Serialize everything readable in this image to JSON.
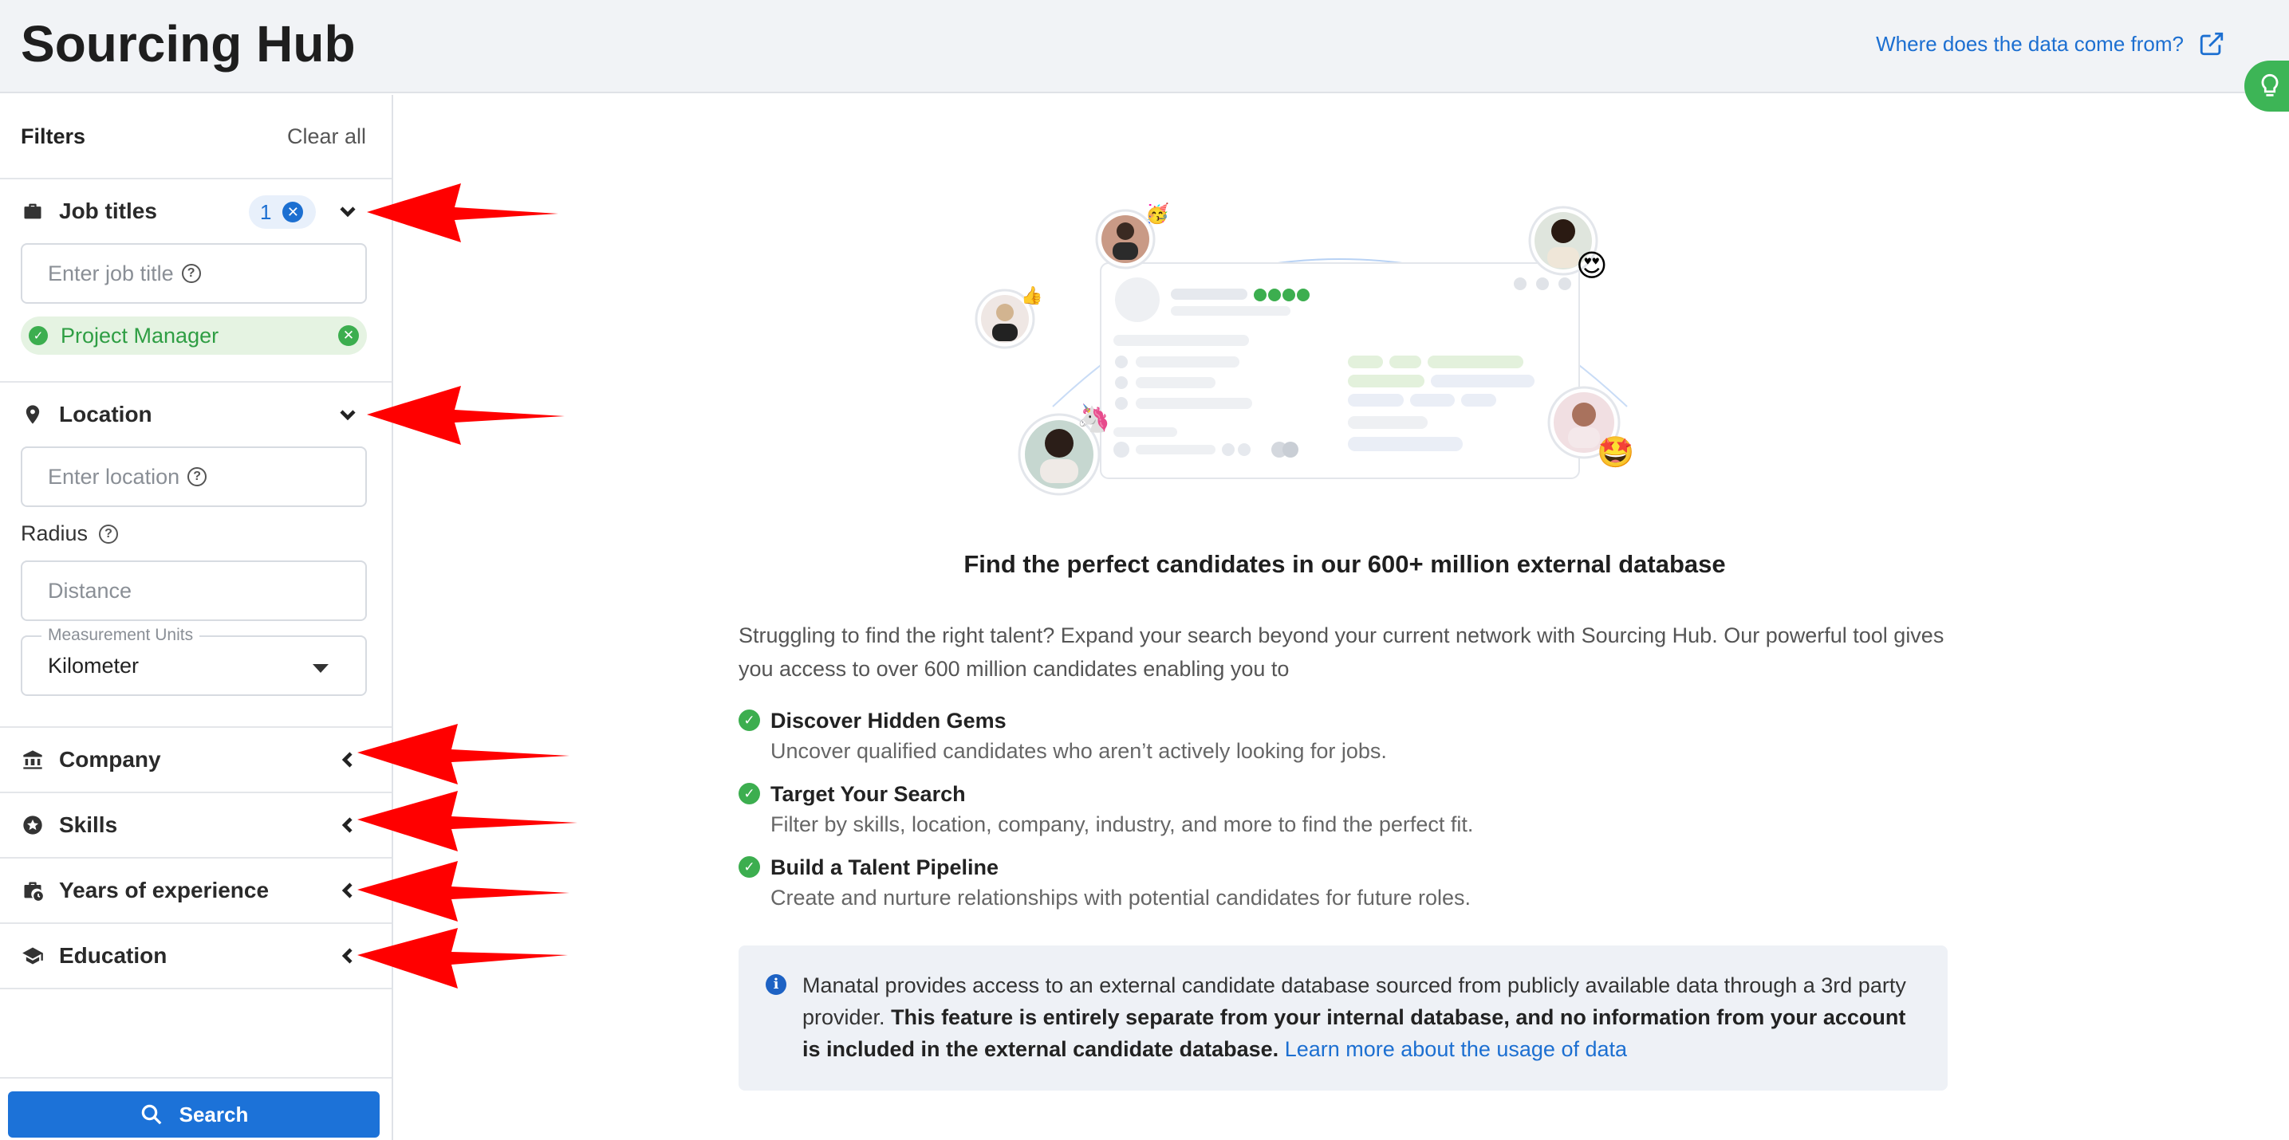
{
  "header": {
    "title": "Sourcing Hub",
    "data_link": "Where does the data come from?"
  },
  "sidebar": {
    "filters_title": "Filters",
    "clear_all": "Clear all",
    "job_titles": {
      "label": "Job titles",
      "count": "1",
      "placeholder": "Enter job title",
      "chip": "Project Manager"
    },
    "location": {
      "label": "Location",
      "placeholder": "Enter location",
      "radius_label": "Radius",
      "distance_placeholder": "Distance",
      "units_legend": "Measurement Units",
      "units_value": "Kilometer"
    },
    "sections": [
      {
        "label": "Company",
        "icon": "bank-icon"
      },
      {
        "label": "Skills",
        "icon": "star-badge-icon"
      },
      {
        "label": "Years of experience",
        "icon": "briefcase-clock-icon"
      },
      {
        "label": "Education",
        "icon": "graduation-cap-icon"
      }
    ],
    "search_button": "Search"
  },
  "main": {
    "headline": "Find the perfect candidates in our 600+ million external database",
    "intro": "Struggling to find the right talent? Expand your search beyond your current network with Sourcing Hub. Our powerful tool gives you access to over 600 million candidates enabling you to",
    "features": [
      {
        "title": "Discover Hidden Gems",
        "desc": "Uncover qualified candidates who aren’t actively looking for jobs."
      },
      {
        "title": "Target Your Search",
        "desc": "Filter by skills, location, company, industry, and more to find the perfect fit."
      },
      {
        "title": "Build a Talent Pipeline",
        "desc": "Create and nurture relationships with potential candidates for future roles."
      }
    ],
    "notice": {
      "text1": "Manatal provides access to an external candidate database sourced from publicly available data through a 3rd party provider. ",
      "bold": "This feature is entirely separate from your internal database, and no information from your account is included in the external candidate database.",
      "link": "Learn more about the usage of data"
    }
  },
  "colors": {
    "accent": "#1c72d8",
    "success": "#3cae4f",
    "annotation": "#ff0000"
  }
}
